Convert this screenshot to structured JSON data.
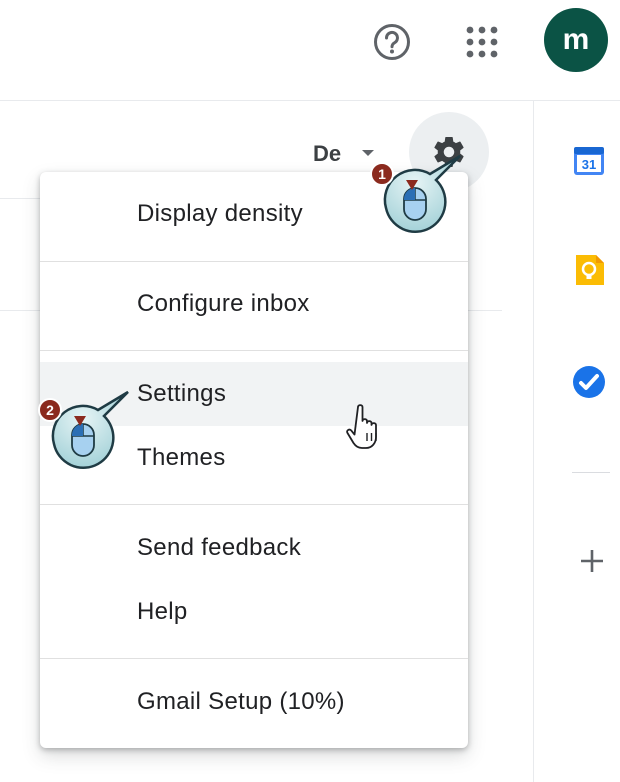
{
  "header": {
    "help_icon": "help-circle-icon",
    "apps_icon": "apps-grid-icon",
    "avatar_letter": "m",
    "avatar_color": "#0b5345"
  },
  "toolbar": {
    "density_text": "De",
    "settings_icon": "gear-icon"
  },
  "side_panel": {
    "calendar_day": "31",
    "items": [
      "calendar-icon",
      "keep-icon",
      "tasks-icon",
      "add-icon"
    ]
  },
  "menu": {
    "items": [
      {
        "label": "Display density"
      },
      {
        "label": "Configure inbox"
      },
      {
        "label": "Settings",
        "hovered": true
      },
      {
        "label": "Themes"
      },
      {
        "label": "Send feedback"
      },
      {
        "label": "Help"
      },
      {
        "label": "Gmail Setup (10%)"
      }
    ]
  },
  "steps": [
    {
      "number": "1",
      "action": "mouse-click-icon"
    },
    {
      "number": "2",
      "action": "mouse-click-icon"
    }
  ],
  "colors": {
    "accent_blue": "#1a73e8",
    "hover_bg": "#f1f3f4",
    "step_badge": "#8b2a1e",
    "callout_fill": "#bcdfe3"
  }
}
